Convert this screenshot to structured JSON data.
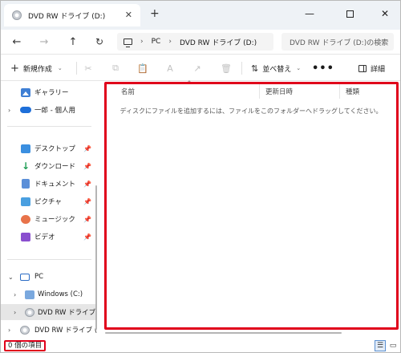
{
  "window": {
    "tab_title": "DVD RW ドライブ (D:)",
    "tab_close": "✕",
    "new_tab": "+",
    "minimize": "—",
    "close": "✕"
  },
  "address": {
    "back": "←",
    "forward": "→",
    "up": "↑",
    "refresh": "↻",
    "crumb_sep": "›",
    "crumbs": [
      "PC",
      "DVD RW ドライブ (D:)"
    ],
    "search_placeholder": "DVD RW ドライブ (D:)の検索"
  },
  "commandbar": {
    "new_label": "新規作成",
    "new_icon": "+",
    "chevron": "⌄",
    "sort_label": "並べ替え",
    "sort_icon": "⇅",
    "more_label": "•••",
    "details_label": "詳細",
    "disabled_icons": [
      "✂",
      "⧉",
      "📋",
      "A",
      "↗",
      "🗑"
    ]
  },
  "sidebar": {
    "chevron_right": "›",
    "chevron_down": "⌄",
    "pin": "📌",
    "gallery": "ギャラリー",
    "onedrive": "一郎 - 個人用",
    "quick": [
      {
        "label": "デスクトップ"
      },
      {
        "label": "ダウンロード",
        "icon_char": "↓"
      },
      {
        "label": "ドキュメント"
      },
      {
        "label": "ピクチャ"
      },
      {
        "label": "ミュージック"
      },
      {
        "label": "ビデオ"
      }
    ],
    "pc": "PC",
    "windows_c": "Windows (C:)",
    "dvd_selected": "DVD RW ドライブ (D:",
    "dvd_bottom": "DVD RW ドライブ (D:)"
  },
  "content": {
    "columns": [
      "名前",
      "更新日時",
      "種類"
    ],
    "sort_caret": "^",
    "empty_message": "ディスクにファイルを追加するには、ファイルをこのフォルダーへドラッグしてください。"
  },
  "status": {
    "item_count": "0 個の項目",
    "details_view_icon": "☰",
    "tiles_view_icon": "▭"
  },
  "colors": {
    "highlight": "#e0001b",
    "accent": "#0067c0"
  }
}
